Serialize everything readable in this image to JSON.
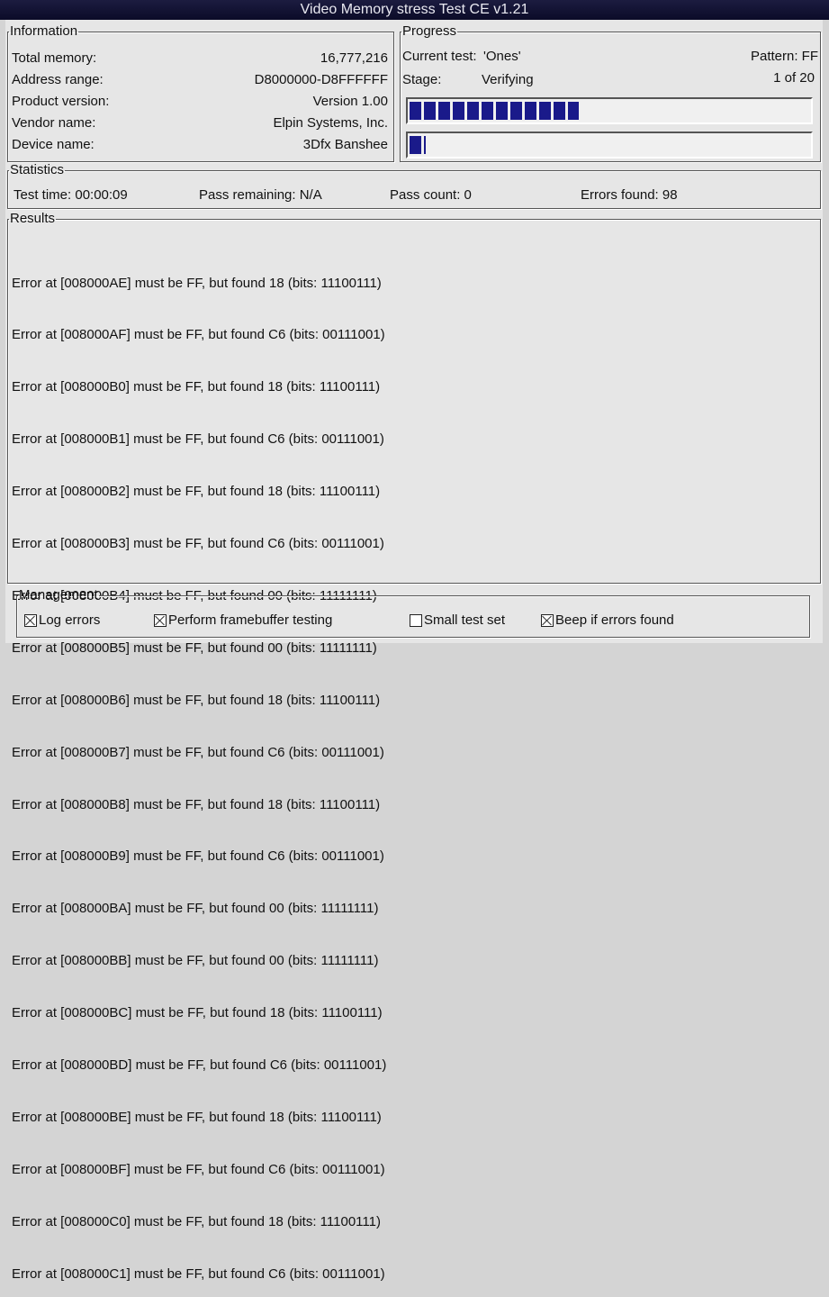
{
  "window": {
    "title": "Video Memory stress Test CE v1.21"
  },
  "information": {
    "legend": "Information",
    "rows": [
      {
        "label": "Total memory:",
        "value": "16,777,216"
      },
      {
        "label": "Address range:",
        "value": "D8000000-D8FFFFFF"
      },
      {
        "label": "Product version:",
        "value": "Version 1.00"
      },
      {
        "label": "Vendor name:",
        "value": "Elpin Systems, Inc."
      },
      {
        "label": "Device name:",
        "value": "3Dfx Banshee"
      }
    ]
  },
  "progress": {
    "legend": "Progress",
    "current_test_label": "Current test:",
    "current_test_value": "'Ones'",
    "pattern": "Pattern: FF",
    "stage_label": "Stage:",
    "stage_value": "Verifying",
    "pass_of": "1 of 20",
    "bar1_fraction": 0.42,
    "bar2_fraction": 0.04
  },
  "statistics": {
    "legend": "Statistics",
    "test_time": "Test time:  00:00:09",
    "pass_remaining": "Pass remaining:  N/A",
    "pass_count": "Pass count:  0",
    "errors_found": "Errors found:  98"
  },
  "results": {
    "legend": "Results",
    "lines": [
      "Error at [008000AE] must be FF, but found 18 (bits: 11100111)",
      "Error at [008000AF] must be FF, but found C6 (bits: 00111001)",
      "Error at [008000B0] must be FF, but found 18 (bits: 11100111)",
      "Error at [008000B1] must be FF, but found C6 (bits: 00111001)",
      "Error at [008000B2] must be FF, but found 18 (bits: 11100111)",
      "Error at [008000B3] must be FF, but found C6 (bits: 00111001)",
      "Error at [008000B4] must be FF, but found 00 (bits: 11111111)",
      "Error at [008000B5] must be FF, but found 00 (bits: 11111111)",
      "Error at [008000B6] must be FF, but found 18 (bits: 11100111)",
      "Error at [008000B7] must be FF, but found C6 (bits: 00111001)",
      "Error at [008000B8] must be FF, but found 18 (bits: 11100111)",
      "Error at [008000B9] must be FF, but found C6 (bits: 00111001)",
      "Error at [008000BA] must be FF, but found 00 (bits: 11111111)",
      "Error at [008000BB] must be FF, but found 00 (bits: 11111111)",
      "Error at [008000BC] must be FF, but found 18 (bits: 11100111)",
      "Error at [008000BD] must be FF, but found C6 (bits: 00111001)",
      "Error at [008000BE] must be FF, but found 18 (bits: 11100111)",
      "Error at [008000BF] must be FF, but found C6 (bits: 00111001)",
      "Error at [008000C0] must be FF, but found 18 (bits: 11100111)",
      "Error at [008000C1] must be FF, but found C6 (bits: 00111001)"
    ]
  },
  "management": {
    "legend": "Management",
    "options": [
      {
        "label": "Log errors",
        "checked": true
      },
      {
        "label": "Perform framebuffer testing",
        "checked": true
      },
      {
        "label": "Small test set",
        "checked": false
      },
      {
        "label": "Beep if errors found",
        "checked": true
      }
    ]
  },
  "colors": {
    "progress_fill": "#1a1a8a",
    "titlebar": "#0b0b28"
  }
}
